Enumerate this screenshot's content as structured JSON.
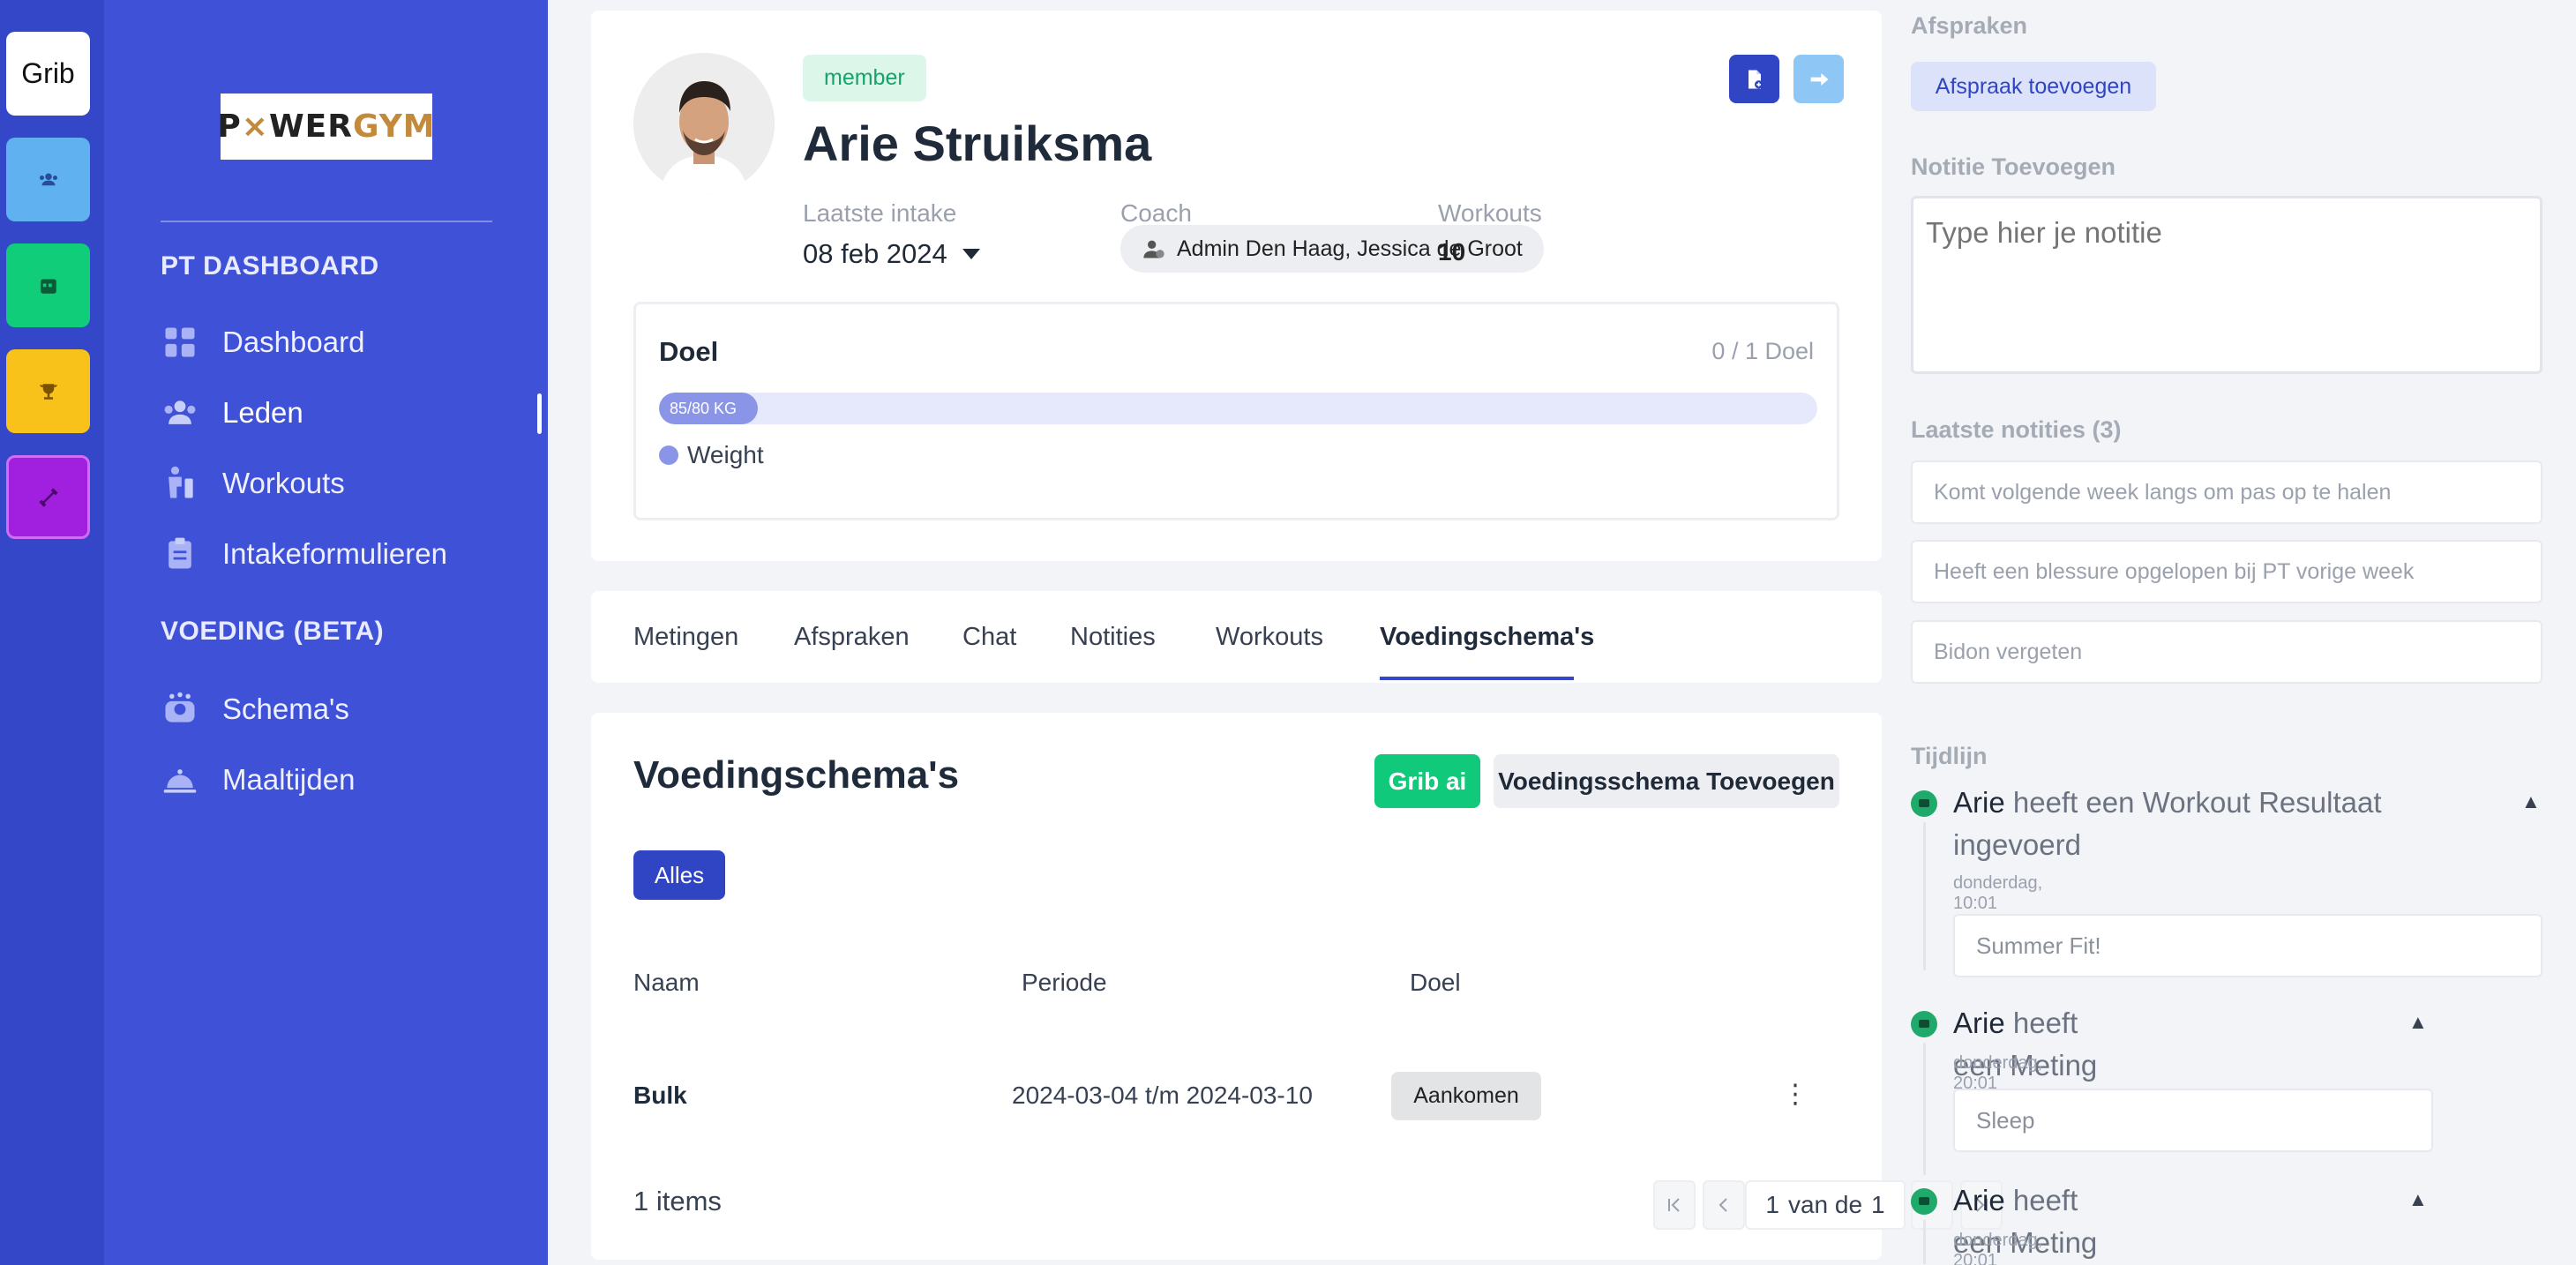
{
  "rail": {
    "brand": "Grib",
    "colors": {
      "brand_bg": "#ffffff",
      "members_bg": "#5fb1f0",
      "calendar_bg": "#0fcd78",
      "trophy_bg": "#f8c21a",
      "dumbbell_bg": "#a11fde"
    },
    "icons": [
      "users-icon",
      "calendar-icon",
      "trophy-icon",
      "dumbbell-icon"
    ]
  },
  "sidebar": {
    "logo": {
      "part1": "P",
      "mark": "×",
      "part2": "WER",
      "part3": "GYM"
    },
    "section_pt": "PT DASHBOARD",
    "pt_items": [
      {
        "label": "Dashboard",
        "icon": "dashboard-icon"
      },
      {
        "label": "Leden",
        "icon": "users-icon"
      },
      {
        "label": "Workouts",
        "icon": "workout-icon"
      },
      {
        "label": "Intakeformulieren",
        "icon": "clipboard-icon"
      }
    ],
    "active_item": "Leden",
    "section_voeding": "VOEDING (BETA)",
    "voeding_items": [
      {
        "label": "Schema's",
        "icon": "scale-icon"
      },
      {
        "label": "Maaltijden",
        "icon": "cloche-icon"
      }
    ]
  },
  "profile": {
    "badge": "member",
    "name": "Arie Struiksma",
    "labels": {
      "intake": "Laatste intake",
      "coach": "Coach",
      "workouts": "Workouts"
    },
    "intake_date": "08 feb 2024",
    "coach": "Admin Den Haag, Jessica de Groot",
    "workouts_count": "10",
    "actions": [
      {
        "name": "document-icon",
        "color": "#2f45c4"
      },
      {
        "name": "arrow-right-icon",
        "color": "#8ec7f5"
      }
    ]
  },
  "goal": {
    "title": "Doel",
    "count": "0 / 1 Doel",
    "progress_label": "85/80 KG",
    "progress_fraction": 0.085,
    "legend": "Weight"
  },
  "tabs": {
    "items": [
      "Metingen",
      "Afspraken",
      "Chat",
      "Notities",
      "Workouts",
      "Voedingschema's"
    ],
    "active": "Voedingschema's"
  },
  "schemas": {
    "title": "Voedingschema's",
    "ai_button": "Grib ai",
    "add_button": "Voedingsschema Toevoegen",
    "filter": "Alles",
    "columns": [
      "Naam",
      "Periode",
      "Doel"
    ],
    "rows": [
      {
        "naam": "Bulk",
        "periode": "2024-03-04 t/m 2024-03-10",
        "doel": "Aankomen"
      }
    ],
    "items_count": "1 items",
    "pager": {
      "current": "1",
      "of": "van de",
      "total": "1"
    }
  },
  "right_panel": {
    "appointments_label": "Afspraken",
    "appointments_button": "Afspraak toevoegen",
    "note_label": "Notitie Toevoegen",
    "note_placeholder": "Type hier je notitie",
    "recent_notes_label": "Laatste notities (3)",
    "recent_notes": [
      "Komt volgende week langs om pas op te halen",
      "Heeft een blessure opgelopen bij PT vorige week",
      "Bidon vergeten"
    ],
    "timeline_label": "Tijdlijn",
    "timeline": [
      {
        "who": "Arie",
        "action": "heeft een Workout Resultaat ingevoerd",
        "time": "donderdag, 10:01",
        "detail": "Summer Fit!"
      },
      {
        "who": "Arie",
        "action": "heeft een Meting aangemaakt",
        "time": "donderdag, 20:01",
        "detail": "Sleep"
      },
      {
        "who": "Arie",
        "action": "heeft een Meting aangemaakt",
        "time": "donderdag, 20:01",
        "detail": ""
      }
    ]
  }
}
